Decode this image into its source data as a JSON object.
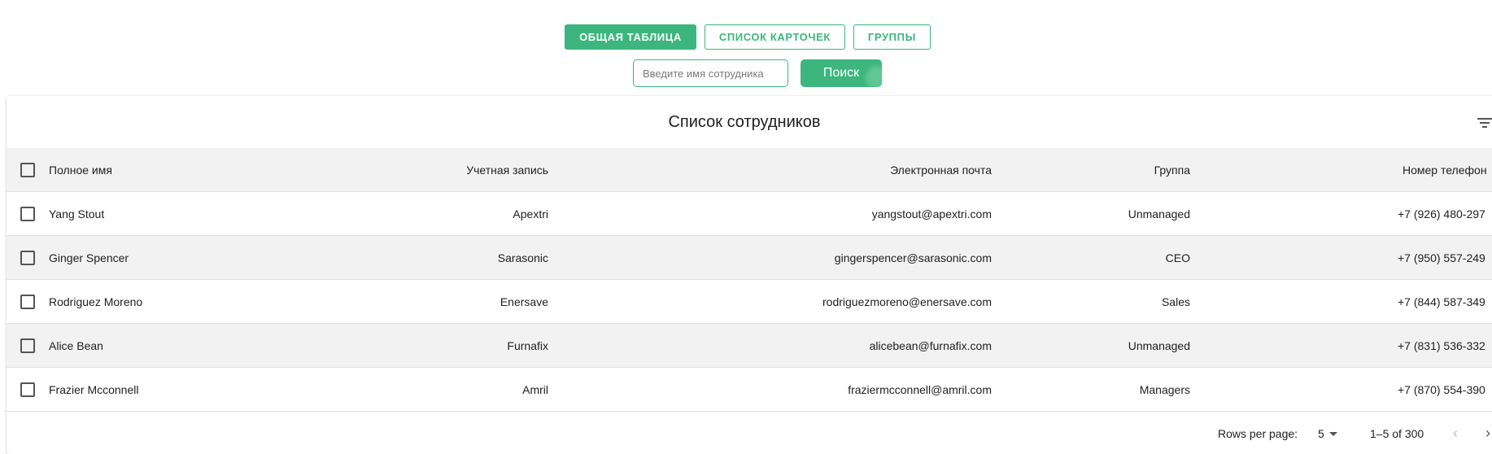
{
  "tabs": [
    {
      "label": "ОБЩАЯ ТАБЛИЦА",
      "active": true
    },
    {
      "label": "СПИСОК КАРТОЧЕК",
      "active": false
    },
    {
      "label": "ГРУППЫ",
      "active": false
    }
  ],
  "search": {
    "placeholder": "Введите имя сотрудника",
    "value": "",
    "button_label": "Поиск"
  },
  "table": {
    "title": "Список сотрудников",
    "columns": [
      "Полное имя",
      "Учетная запись",
      "Электронная почта",
      "Группа",
      "Номер телефон"
    ],
    "rows": [
      {
        "name": "Yang Stout",
        "account": "Apextri",
        "email": "yangstout@apextri.com",
        "group": "Unmanaged",
        "phone": "+7 (926) 480-297"
      },
      {
        "name": "Ginger Spencer",
        "account": "Sarasonic",
        "email": "gingerspencer@sarasonic.com",
        "group": "CEO",
        "phone": "+7 (950) 557-249"
      },
      {
        "name": "Rodriguez Moreno",
        "account": "Enersave",
        "email": "rodriguezmoreno@enersave.com",
        "group": "Sales",
        "phone": "+7 (844) 587-349"
      },
      {
        "name": "Alice Bean",
        "account": "Furnafix",
        "email": "alicebean@furnafix.com",
        "group": "Unmanaged",
        "phone": "+7 (831) 536-332"
      },
      {
        "name": "Frazier Mcconnell",
        "account": "Amril",
        "email": "fraziermcconnell@amril.com",
        "group": "Managers",
        "phone": "+7 (870) 554-390"
      }
    ]
  },
  "pagination": {
    "rows_per_page_label": "Rows per page:",
    "rows_per_page": "5",
    "range": "1–5 of 300"
  },
  "colors": {
    "accent": "#3cb67e",
    "header_bg": "#f2f2f2"
  },
  "icons": [
    "filter-list-icon",
    "chevron-left-icon",
    "chevron-right-icon",
    "dropdown-caret-icon"
  ]
}
